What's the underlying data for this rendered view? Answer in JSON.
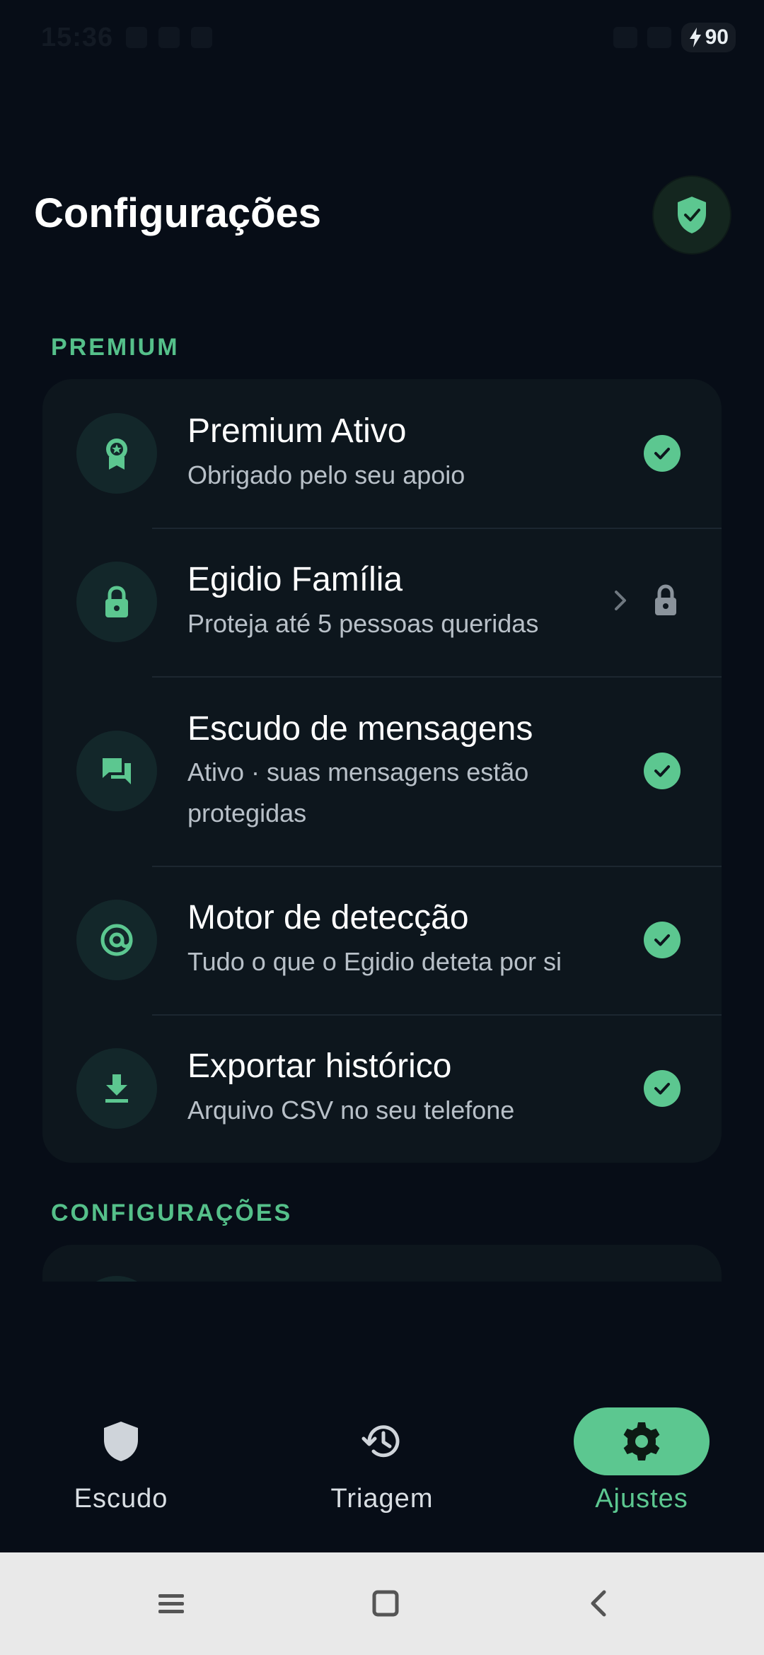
{
  "status_bar": {
    "time": "15:36",
    "battery": "90"
  },
  "header": {
    "title": "Configurações",
    "badge_icon": "shield-check-icon"
  },
  "sections": {
    "premium_label": "PREMIUM",
    "settings_label": "CONFIGURAÇÕES"
  },
  "premium_items": [
    {
      "title": "Premium Ativo",
      "subtitle": "Obrigado pelo seu apoio",
      "icon": "award-icon",
      "status": "check"
    },
    {
      "title": "Egidio Família",
      "subtitle": "Proteja até 5 pessoas queridas",
      "icon": "lock-icon",
      "status": "locked"
    },
    {
      "title": "Escudo de mensagens",
      "subtitle": "Ativo · suas mensagens estão protegidas",
      "icon": "chat-icon",
      "status": "check"
    },
    {
      "title": "Motor de detecção",
      "subtitle": "Tudo o que o Egidio deteta por si",
      "icon": "at-target-icon",
      "status": "check"
    },
    {
      "title": "Exportar histórico",
      "subtitle": "Arquivo CSV no seu telefone",
      "icon": "download-icon",
      "status": "check"
    }
  ],
  "bottom_nav": {
    "items": [
      {
        "label": "Escudo",
        "icon": "shield-icon",
        "active": false
      },
      {
        "label": "Triagem",
        "icon": "history-icon",
        "active": false
      },
      {
        "label": "Ajustes",
        "icon": "gear-icon",
        "active": true
      }
    ]
  },
  "colors": {
    "accent": "#5cc790",
    "background": "#070d17",
    "card": "#0d161d"
  }
}
